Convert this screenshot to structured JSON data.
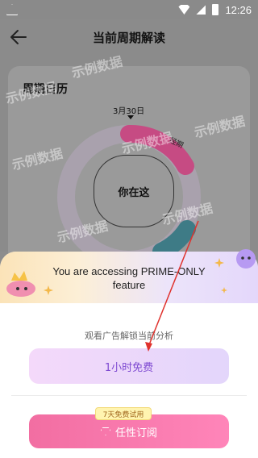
{
  "status_bar": {
    "time": "12:26",
    "icons": [
      "warning-icon",
      "wifi-icon",
      "signal-icon",
      "battery-icon"
    ]
  },
  "header": {
    "title": "当前周期解读",
    "back_icon": "back-arrow-icon"
  },
  "calendar_card": {
    "title": "周期日历",
    "date": "3月30日",
    "period_label": "经期",
    "you_are_here": "你在这"
  },
  "watermark": "示例数据",
  "sheet": {
    "promo_text": "You are accessing PRIME-ONLY feature",
    "hint": "观看广告解锁当前分析",
    "free_button": "1小时免费",
    "trial_badge": "7天免费试用",
    "subscribe_button": "任性订阅"
  },
  "colors": {
    "accent_pink": "#f26ea2",
    "accent_purple": "#7e4ad1",
    "annotation_red": "#e0322d"
  }
}
